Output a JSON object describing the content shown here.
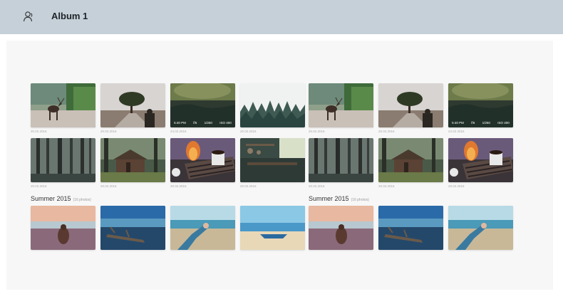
{
  "header": {
    "title": "Album 1",
    "icon": "user-icon",
    "background": "#c5d0d8"
  },
  "rows": [
    {
      "photos": [
        {
          "scene": "deer",
          "date": "20.02.2016"
        },
        {
          "scene": "tree",
          "date": "20.02.2016"
        },
        {
          "scene": "forest-misty",
          "date": "24.02.2016",
          "exif": [
            "5:40 PM",
            "f/6",
            "1/250",
            "ISO 400"
          ]
        },
        {
          "scene": "pines-fog",
          "date": "20.02.2016"
        },
        {
          "scene": "deer",
          "date": "20.02.2016"
        },
        {
          "scene": "tree",
          "date": "20.02.2016"
        },
        {
          "scene": "forest-misty",
          "date": "24.02.2016",
          "exif": [
            "5:40 PM",
            "f/6",
            "1/250",
            "ISO 400"
          ]
        }
      ]
    },
    {
      "photos": [
        {
          "scene": "dark-forest",
          "date": "20.02.2016"
        },
        {
          "scene": "cabin",
          "date": "20.02.2016"
        },
        {
          "scene": "fire-cup",
          "date": "20.02.2016"
        },
        {
          "scene": "kitchen",
          "date": "20.02.2016"
        },
        {
          "scene": "dark-forest",
          "date": "20.02.2016"
        },
        {
          "scene": "cabin",
          "date": "20.02.2016"
        },
        {
          "scene": "fire-cup",
          "date": "20.02.2016"
        }
      ]
    }
  ],
  "sections": [
    {
      "title": "Summer 2015",
      "count": "(16 photos)"
    },
    {
      "title": "Summer 2015",
      "count": "(16 photos)"
    }
  ],
  "summer_row": {
    "photos": [
      {
        "scene": "beach-girl"
      },
      {
        "scene": "beach-log"
      },
      {
        "scene": "hand-sea"
      },
      {
        "scene": "boat"
      },
      {
        "scene": "beach-girl"
      },
      {
        "scene": "beach-log"
      },
      {
        "scene": "hand-sea"
      }
    ]
  }
}
